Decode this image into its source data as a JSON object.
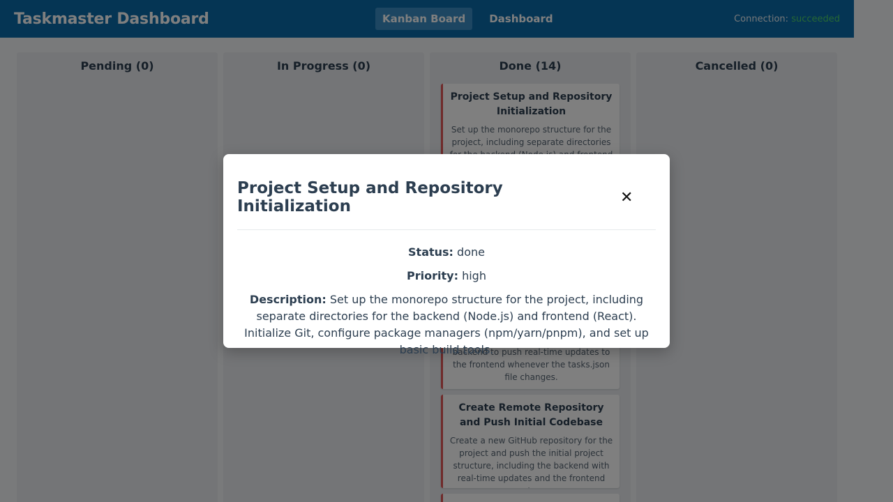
{
  "header": {
    "title": "Taskmaster Dashboard",
    "nav": [
      {
        "label": "Kanban Board",
        "active": true
      },
      {
        "label": "Dashboard",
        "active": false
      }
    ],
    "connection_label": "Connection:",
    "connection_status": "succeeded",
    "colors": {
      "bar": "#0b6aa8",
      "status_ok": "#4cd06a"
    }
  },
  "columns": [
    {
      "title": "Pending (0)",
      "cards": []
    },
    {
      "title": "In Progress (0)",
      "cards": []
    },
    {
      "title": "Done (14)",
      "cards": [
        {
          "title": "Project Setup and Repository Initialization",
          "description": "Set up the monorepo structure for the project, including separate directories for the backend (Node.js) and frontend"
        },
        {
          "title": "",
          "description": "backend to push real-time updates to the frontend whenever the tasks.json file changes."
        },
        {
          "title": "Create Remote Repository and Push Initial Codebase",
          "description": "Create a new GitHub repository for the project and push the initial project structure, including the backend with real-time updates and the frontend setup."
        }
      ]
    },
    {
      "title": "Cancelled (0)",
      "cards": []
    }
  ],
  "modal": {
    "title": "Project Setup and Repository Initialization",
    "close_icon": "close-icon",
    "status_label": "Status:",
    "status_value": "done",
    "priority_label": "Priority:",
    "priority_value": "high",
    "description_label": "Description:",
    "description_value": "Set up the monorepo structure for the project, including separate directories for the backend (Node.js) and frontend (React). Initialize Git, configure package managers (npm/yarn/pnpm), and set up basic build tools."
  }
}
